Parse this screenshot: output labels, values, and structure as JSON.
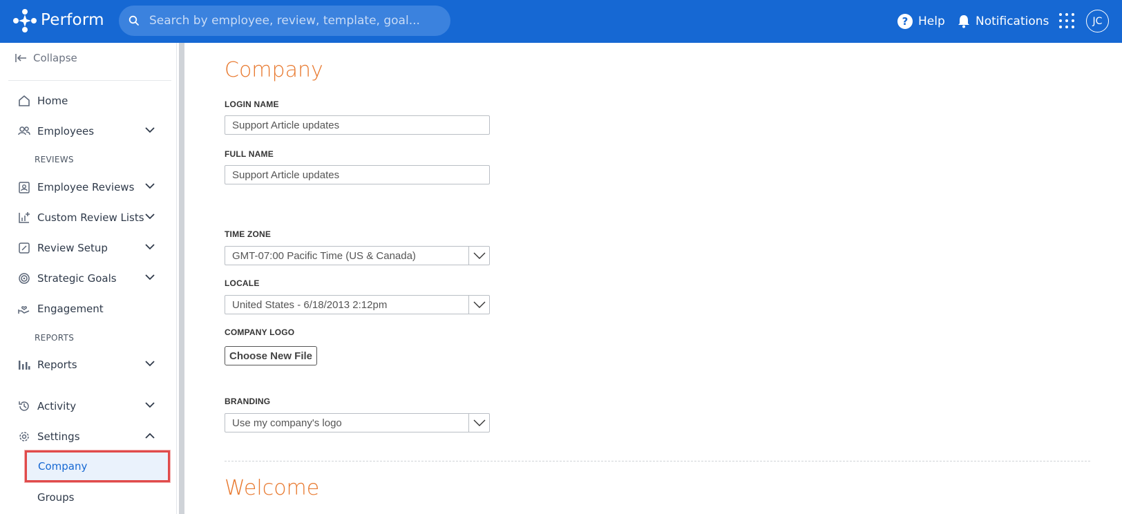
{
  "header": {
    "app_name": "Perform",
    "search_placeholder": "Search by employee, review, template, goal...",
    "help_label": "Help",
    "notifications_label": "Notifications",
    "avatar_initials": "JC"
  },
  "sidebar": {
    "collapse_label": "Collapse",
    "section_reviews": "REVIEWS",
    "section_reports": "REPORTS",
    "items": {
      "home": "Home",
      "employees": "Employees",
      "employee_reviews": "Employee Reviews",
      "custom_review_lists": "Custom Review Lists",
      "review_setup": "Review Setup",
      "strategic_goals": "Strategic Goals",
      "engagement": "Engagement",
      "reports": "Reports",
      "activity": "Activity",
      "settings": "Settings",
      "company": "Company",
      "groups": "Groups"
    }
  },
  "main": {
    "company_title": "Company",
    "login_name_label": "LOGIN NAME",
    "login_name_value": "Support Article updates",
    "full_name_label": "FULL NAME",
    "full_name_value": "Support Article updates",
    "time_zone_label": "TIME ZONE",
    "time_zone_value": "GMT-07:00 Pacific Time (US & Canada)",
    "locale_label": "LOCALE",
    "locale_value": "United States - 6/18/2013 2:12pm",
    "company_logo_label": "COMPANY LOGO",
    "choose_file_label": "Choose New File",
    "branding_label": "BRANDING",
    "branding_value": "Use my company's logo",
    "welcome_title": "Welcome"
  },
  "colors": {
    "header_blue": "#1668d3",
    "accent_orange": "#e8792f",
    "highlight_red": "#e04b4b"
  }
}
